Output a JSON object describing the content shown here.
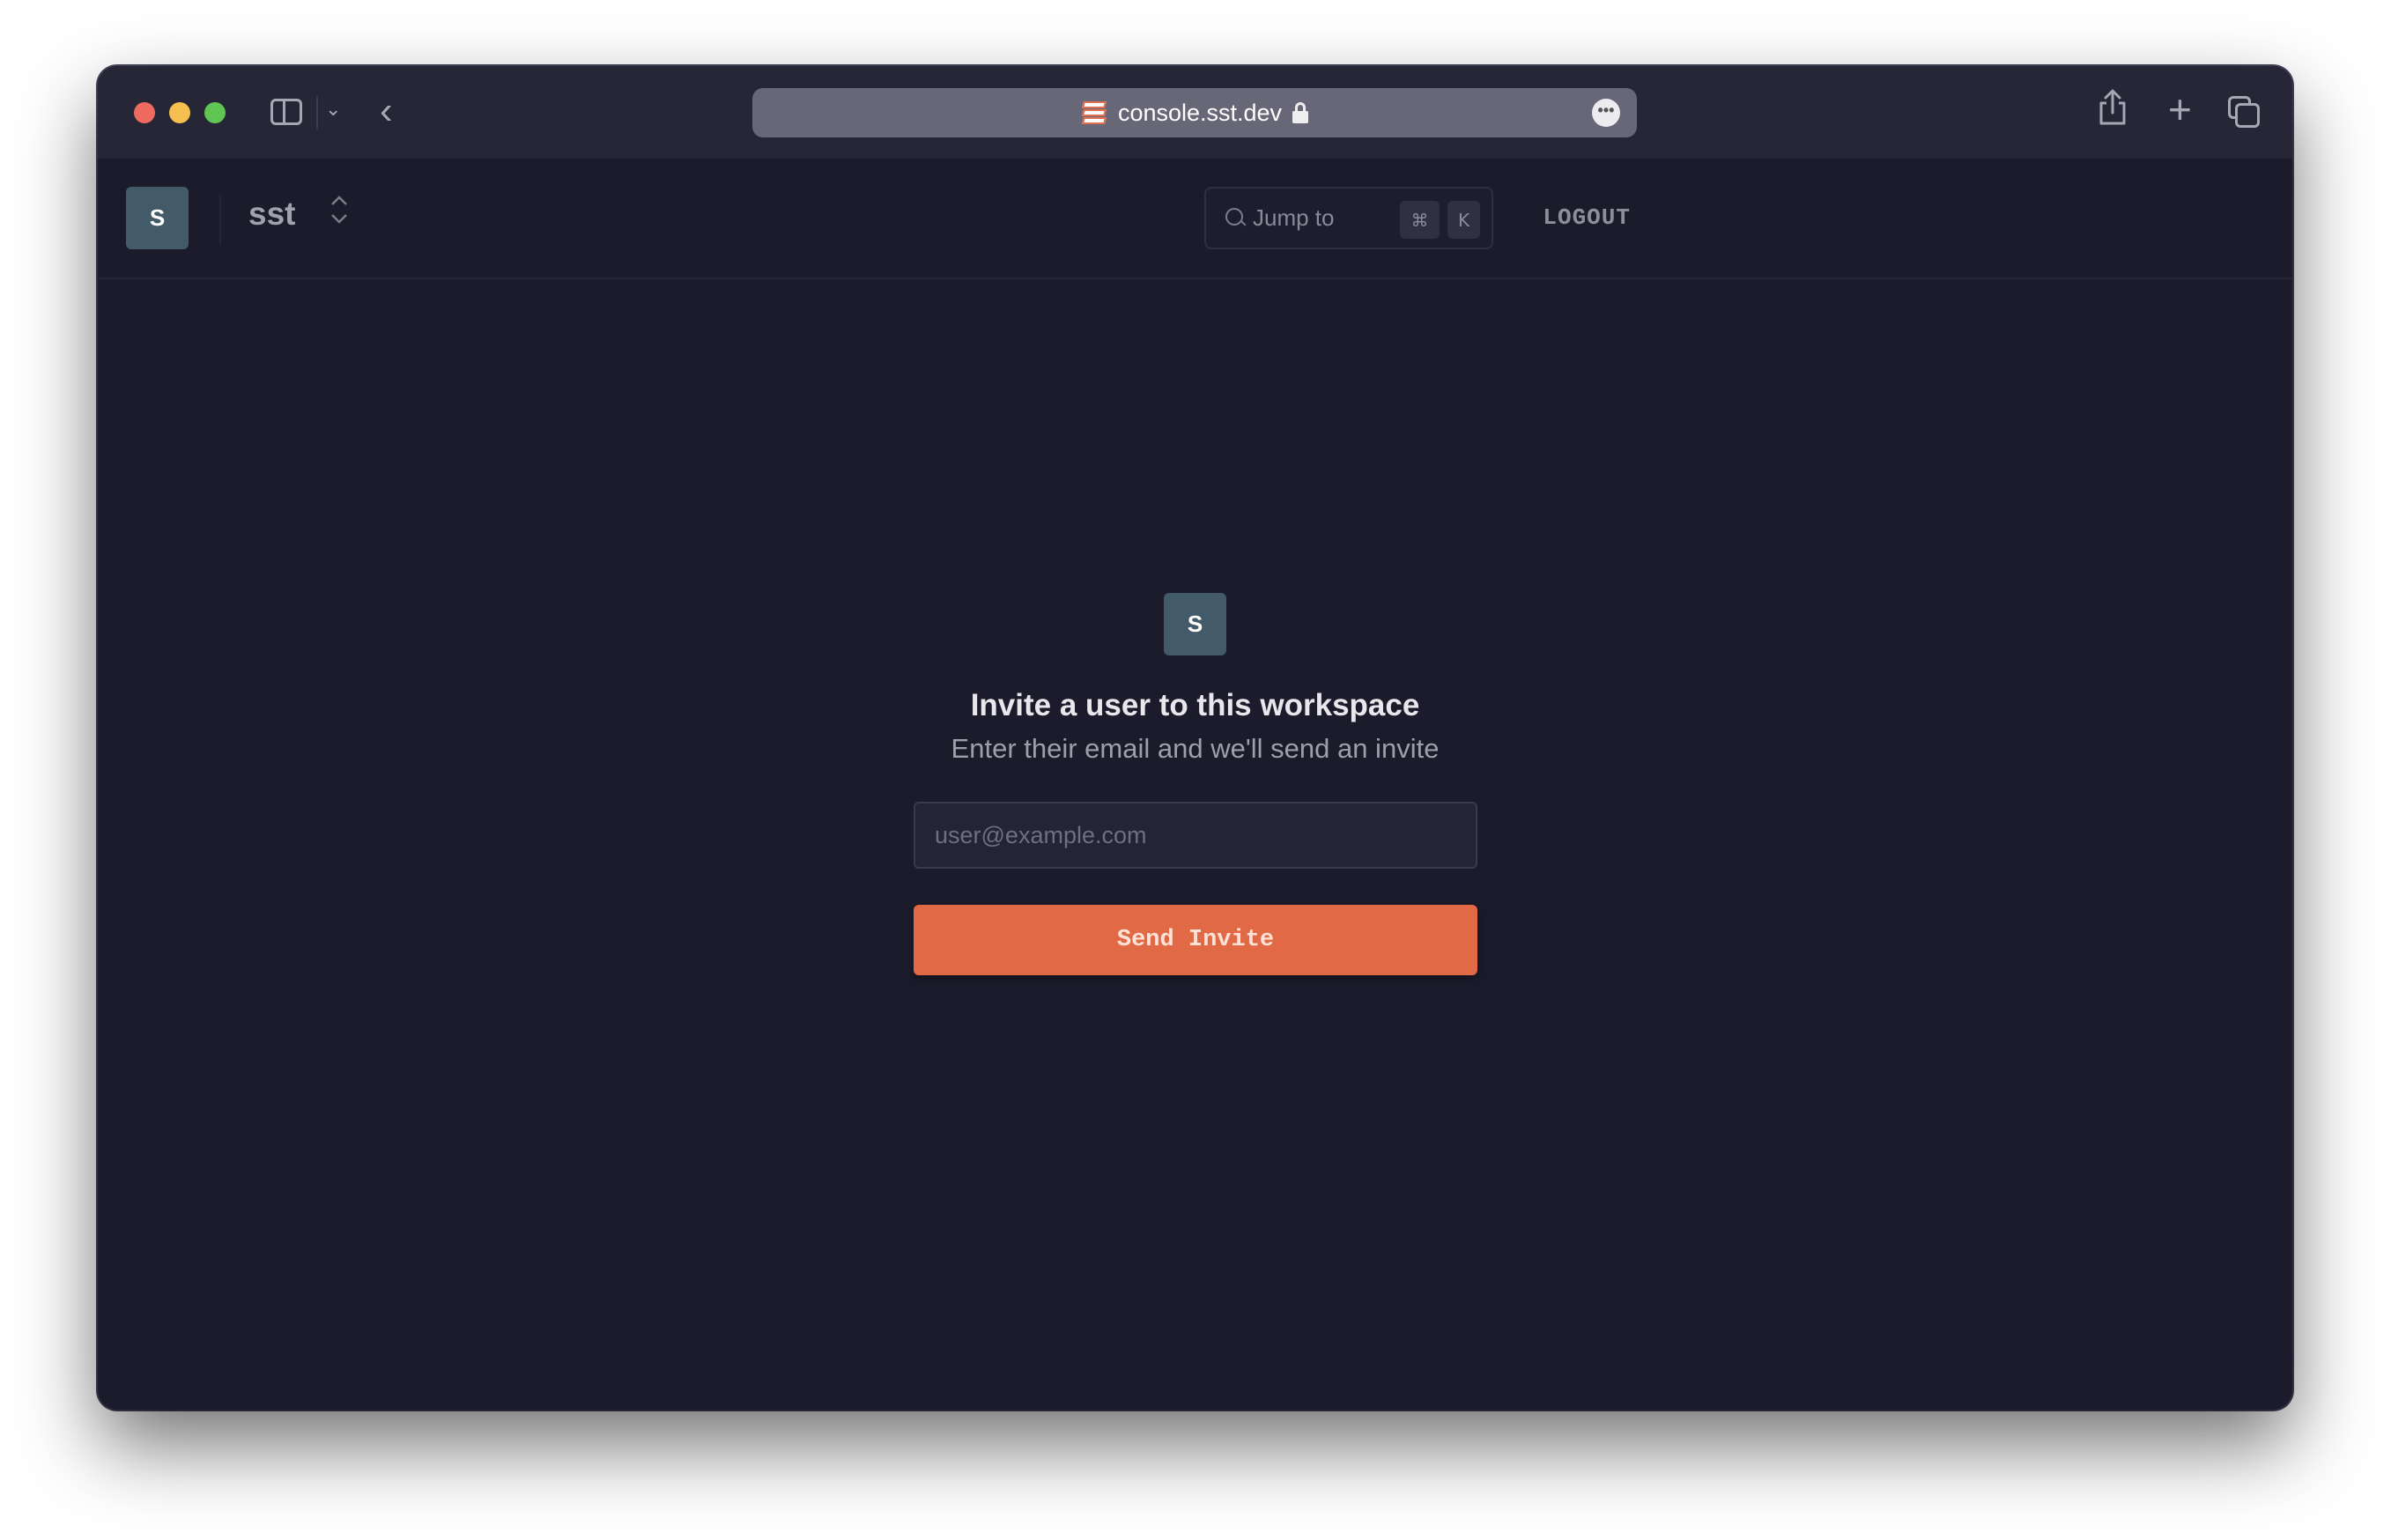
{
  "browser": {
    "url": "console.sst.dev",
    "traffic_lights": [
      "close",
      "minimize",
      "zoom"
    ],
    "icons": {
      "sidebar": "sidebar-icon",
      "chevron": "chevron-down-icon",
      "back": "back-icon",
      "more": "more-icon",
      "share": "share-icon",
      "new_tab": "plus-icon",
      "tabs": "tabs-overview-icon"
    },
    "glyphs": {
      "chevron": "⌄",
      "back": "‹",
      "more": "•••",
      "plus": "+"
    }
  },
  "header": {
    "workspace_initial": "S",
    "workspace_name": "sst",
    "switcher_glyph": "⌃⌄",
    "jump_placeholder": "Jump to",
    "kbd_cmd": "⌘",
    "kbd_k": "K",
    "logout_label": "LOGOUT"
  },
  "invite": {
    "avatar_initial": "S",
    "title": "Invite a user to this workspace",
    "subtitle": "Enter their email and we'll send an invite",
    "email_value": "",
    "email_placeholder": "user@example.com",
    "submit_label": "Send Invite"
  },
  "colors": {
    "background": "#1b1b2c",
    "accent": "#e26946",
    "avatar": "#435a68"
  }
}
